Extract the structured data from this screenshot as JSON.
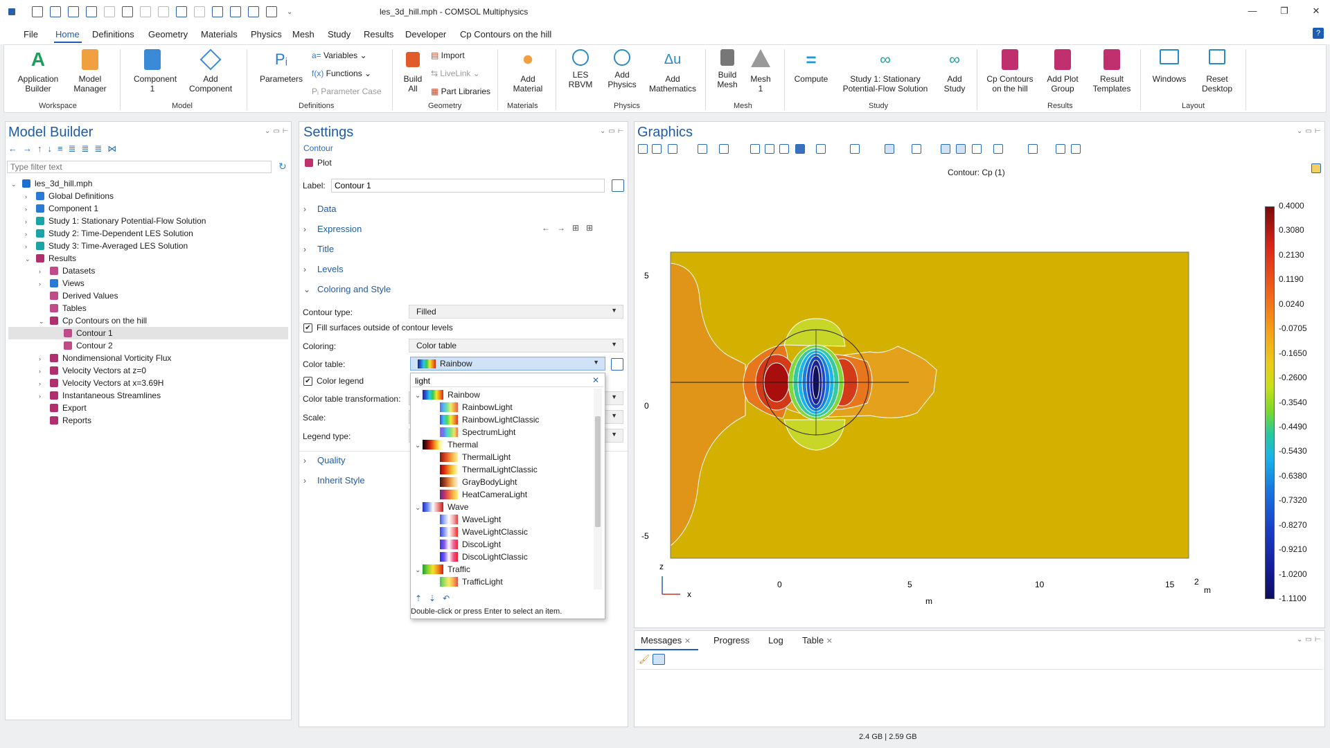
{
  "window": {
    "title": "les_3d_hill.mph - COMSOL Multiphysics",
    "controls": [
      "—",
      "❐",
      "✕"
    ]
  },
  "menu": {
    "items": [
      "File",
      "Home",
      "Definitions",
      "Geometry",
      "Materials",
      "Physics",
      "Mesh",
      "Study",
      "Results",
      "Developer",
      "Cp Contours on the hill"
    ],
    "active": "Home",
    "help": "?"
  },
  "ribbon": {
    "app_builder": "Application Builder",
    "model_manager": "Model Manager",
    "component": "Component 1",
    "add_component": "Add Component",
    "parameters": "Parameters",
    "variables": "Variables",
    "functions": "Functions",
    "parameter_case": "Parameter Case",
    "build_all": "Build All",
    "import": "Import",
    "livelink": "LiveLink",
    "part_libraries": "Part Libraries",
    "add_material": "Add Material",
    "les_rbvm": "LES RBVM",
    "add_physics": "Add Physics",
    "add_math": "Add Mathematics",
    "build_mesh": "Build Mesh",
    "mesh1": "Mesh 1",
    "compute": "Compute",
    "study1": "Study 1: Stationary Potential-Flow Solution",
    "add_study": "Add Study",
    "cp_contours": "Cp Contours on the hill",
    "add_plot_group": "Add Plot Group",
    "result_templates": "Result Templates",
    "windows": "Windows",
    "reset_desktop": "Reset Desktop",
    "groups": {
      "workspace": "Workspace",
      "model": "Model",
      "definitions": "Definitions",
      "geometry": "Geometry",
      "materials": "Materials",
      "physics": "Physics",
      "mesh": "Mesh",
      "study": "Study",
      "results": "Results",
      "layout": "Layout"
    }
  },
  "model_builder": {
    "title": "Model Builder",
    "filter_placeholder": "Type filter text",
    "tree": [
      {
        "label": "les_3d_hill.mph",
        "depth": 0,
        "exp": "v",
        "color": "#1f6fd1"
      },
      {
        "label": "Global Definitions",
        "depth": 1,
        "exp": ">",
        "color": "#2a7bd6"
      },
      {
        "label": "Component 1",
        "depth": 1,
        "exp": ">",
        "color": "#2a7bd6"
      },
      {
        "label": "Study 1: Stationary Potential-Flow Solution",
        "depth": 1,
        "exp": ">",
        "color": "#1aa4a4"
      },
      {
        "label": "Study 2: Time-Dependent LES Solution",
        "depth": 1,
        "exp": ">",
        "color": "#1aa4a4"
      },
      {
        "label": "Study 3: Time-Averaged LES Solution",
        "depth": 1,
        "exp": ">",
        "color": "#1aa4a4"
      },
      {
        "label": "Results",
        "depth": 1,
        "exp": "v",
        "color": "#b0306e"
      },
      {
        "label": "Datasets",
        "depth": 2,
        "exp": ">",
        "color": "#c04a8a"
      },
      {
        "label": "Views",
        "depth": 2,
        "exp": ">",
        "color": "#2a7bd6"
      },
      {
        "label": "Derived Values",
        "depth": 2,
        "exp": "",
        "color": "#c04a8a"
      },
      {
        "label": "Tables",
        "depth": 2,
        "exp": "",
        "color": "#c04a8a"
      },
      {
        "label": "Cp Contours on the hill",
        "depth": 2,
        "exp": "v",
        "color": "#b0306e"
      },
      {
        "label": "Contour 1",
        "depth": 3,
        "exp": "",
        "color": "#c04a8a",
        "selected": true
      },
      {
        "label": "Contour 2",
        "depth": 3,
        "exp": "",
        "color": "#c04a8a"
      },
      {
        "label": "Nondimensional Vorticity Flux",
        "depth": 2,
        "exp": ">",
        "color": "#b0306e"
      },
      {
        "label": "Velocity Vectors at z=0",
        "depth": 2,
        "exp": ">",
        "color": "#b0306e"
      },
      {
        "label": "Velocity Vectors at x=3.69H",
        "depth": 2,
        "exp": ">",
        "color": "#b0306e"
      },
      {
        "label": "Instantaneous Streamlines",
        "depth": 2,
        "exp": ">",
        "color": "#b0306e"
      },
      {
        "label": "Export",
        "depth": 2,
        "exp": "",
        "color": "#b0306e"
      },
      {
        "label": "Reports",
        "depth": 2,
        "exp": "",
        "color": "#b0306e"
      }
    ]
  },
  "settings": {
    "title": "Settings",
    "subtitle": "Contour",
    "plot_label": "Plot",
    "label_caption": "Label:",
    "label_value": "Contour 1",
    "sections": {
      "data": "Data",
      "expression": "Expression",
      "title": "Title",
      "levels": "Levels",
      "coloring_style": "Coloring and Style",
      "quality": "Quality",
      "inherit_style": "Inherit Style"
    },
    "contour_type_label": "Contour type:",
    "contour_type_value": "Filled",
    "fill_surfaces_label": "Fill surfaces outside of contour levels",
    "coloring_label": "Coloring:",
    "coloring_value": "Color table",
    "color_table_label": "Color table:",
    "color_table_value": "Rainbow",
    "color_legend_label": "Color legend",
    "transformation_label": "Color table transformation:",
    "scale_label": "Scale:",
    "legend_type_label": "Legend type:"
  },
  "popup": {
    "search_value": "light",
    "clear": "✕",
    "hint": "Double-click or press Enter to select an item.",
    "items": [
      {
        "label": "Rainbow",
        "group": true,
        "grad": "linear-gradient(90deg,#2b1e8f,#1e62d6,#28c9e0,#34c853,#f4e62b,#f08a1a,#d8261a)"
      },
      {
        "label": "RainbowLight",
        "group": false,
        "grad": "linear-gradient(90deg,#5d6fe0,#52b8f0,#72e0a0,#ecf06a,#f4a64a,#e85e4a)"
      },
      {
        "label": "RainbowLightClassic",
        "group": false,
        "grad": "linear-gradient(90deg,#3f3fe8,#3fc2f0,#44d85a,#f0ec3a,#f09a2a,#e0362a)"
      },
      {
        "label": "SpectrumLight",
        "group": false,
        "grad": "linear-gradient(90deg,#a254e8,#5f7cf0,#4fd2d0,#7ee27a,#f3e264,#f2764a)"
      },
      {
        "label": "Thermal",
        "group": true,
        "grad": "linear-gradient(90deg,#000,#6a0a0a,#d82a10,#f79a18,#fff27a,#fff)"
      },
      {
        "label": "ThermalLight",
        "group": false,
        "grad": "linear-gradient(90deg,#7a1b10,#d23c20,#f07a30,#f8c050,#fff0a8)"
      },
      {
        "label": "ThermalLightClassic",
        "group": false,
        "grad": "linear-gradient(90deg,#8a0a0a,#e02a10,#f08a20,#f8d84a,#fffadc)"
      },
      {
        "label": "GrayBodyLight",
        "group": false,
        "grad": "linear-gradient(90deg,#3a1510,#9a3a20,#e0803a,#f8c878,#fff4e0)"
      },
      {
        "label": "HeatCameraLight",
        "group": false,
        "grad": "linear-gradient(90deg,#5a2a8a,#c0306a,#ef6a3a,#f8b84a,#fff07a)"
      },
      {
        "label": "Wave",
        "group": true,
        "grad": "linear-gradient(90deg,#1a2cc0,#6a8af0,#fff,#f08a8a,#c01a1a)"
      },
      {
        "label": "WaveLight",
        "group": false,
        "grad": "linear-gradient(90deg,#3a58e0,#a6b8f4,#fff,#f4b0b0,#e04040)"
      },
      {
        "label": "WaveLightClassic",
        "group": false,
        "grad": "linear-gradient(90deg,#2a40e8,#8a9af8,#fff,#f89a9a,#e82a2a)"
      },
      {
        "label": "DiscoLight",
        "group": false,
        "grad": "linear-gradient(90deg,#2a3ae8,#8a5ae0,#fff,#f06aa0,#e82a3a)"
      },
      {
        "label": "DiscoLightClassic",
        "group": false,
        "grad": "linear-gradient(90deg,#1a2af0,#7a5af0,#fff,#f05a8a,#f01a2a)"
      },
      {
        "label": "Traffic",
        "group": true,
        "grad": "linear-gradient(90deg,#1aa030,#8ad030,#f4e02a,#f08a1a,#d81a1a)"
      },
      {
        "label": "TrafficLight",
        "group": false,
        "grad": "linear-gradient(90deg,#4ac060,#a6e060,#f8ec6a,#f4ac4a,#e8504a)"
      }
    ]
  },
  "graphics": {
    "title": "Graphics",
    "plot_title": "Contour: Cp (1)",
    "y_ticks": [
      "5",
      "0",
      "-5"
    ],
    "x_ticks": [
      "0",
      "5",
      "10",
      "15"
    ],
    "x_end_tick": "2",
    "x_unit": "m",
    "x_axis_label": "m",
    "triad_z": "z",
    "triad_x": "x",
    "colorbar_labels": [
      "0.4000",
      "0.3080",
      "0.2130",
      "0.1190",
      "0.0240",
      "-0.0705",
      "-0.1650",
      "-0.2600",
      "-0.3540",
      "-0.4490",
      "-0.5430",
      "-0.6380",
      "-0.7320",
      "-0.8270",
      "-0.9210",
      "-1.0200",
      "-1.1100"
    ],
    "colorbar_gradient": "linear-gradient(180deg,#7a0a0a 0%,#d8261a 10%,#f0641a 22%,#f4a31a 32%,#e8cc1a 40%,#c8e01a 46%,#7cd82a 52%,#28c8a0 58%,#1ab4e8 64%,#1a78e0 72%,#1a40c8 82%,#141e9a 92%,#0e0e60 100%)",
    "colors": {
      "background": "#d4b100",
      "hill_outline": "#222222"
    }
  },
  "messages": {
    "tabs": [
      "Messages",
      "Progress",
      "Log",
      "Table"
    ]
  },
  "status": {
    "memory": "2.4 GB | 2.59 GB"
  }
}
